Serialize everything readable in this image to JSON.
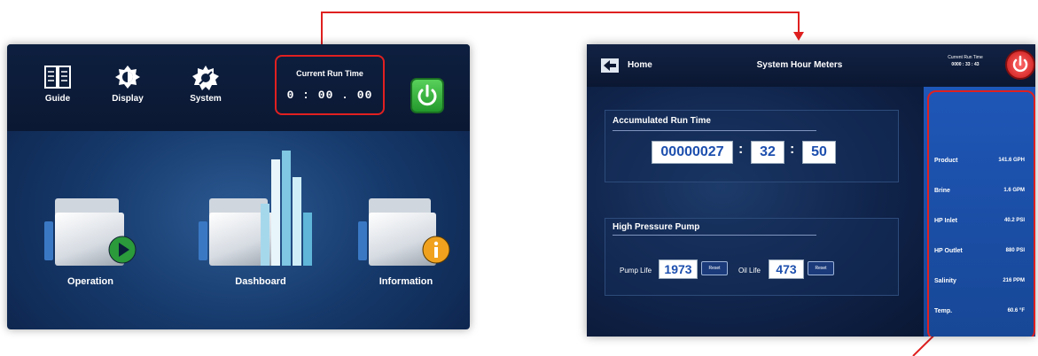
{
  "left_screen": {
    "top_icons": [
      {
        "label": "Guide",
        "icon": "book-icon"
      },
      {
        "label": "Display",
        "icon": "brightness-icon"
      },
      {
        "label": "System",
        "icon": "gear-icon"
      }
    ],
    "run_time": {
      "label": "Current Run Time",
      "value": "0 : 00 . 00"
    },
    "power_icon": "power-icon",
    "apps": [
      {
        "label": "Operation",
        "icon": "play-icon"
      },
      {
        "label": "Dashboard",
        "icon": "bar-chart-icon"
      },
      {
        "label": "Information",
        "icon": "info-icon"
      }
    ]
  },
  "right_screen": {
    "home_label": "Home",
    "title": "System Hour Meters",
    "run_time_small": {
      "label": "Current Run Time",
      "value": "0000 : 33 : 43"
    },
    "accumulated": {
      "title": "Accumulated Run Time",
      "hours": "00000027",
      "minutes": "32",
      "seconds": "50"
    },
    "pump": {
      "title": "High Pressure Pump",
      "pump_life_label": "Pump Life",
      "pump_life_value": "1973",
      "oil_life_label": "Oil Life",
      "oil_life_value": "473",
      "reset_label": "Reset"
    },
    "parameters": [
      {
        "name": "Product",
        "value": "141.6  GPH"
      },
      {
        "name": "Brine",
        "value": "1.6  GPM"
      },
      {
        "name": "HP Inlet",
        "value": "40.2  PSI"
      },
      {
        "name": "HP Outlet",
        "value": "880  PSI"
      },
      {
        "name": "Salinity",
        "value": "216  PPM"
      },
      {
        "name": "Temp.",
        "value": "60.6  °F"
      }
    ]
  },
  "colors": {
    "annotation_red": "#e02020",
    "panel_blue": "#1f57b8",
    "power_green": "#3bb841"
  }
}
